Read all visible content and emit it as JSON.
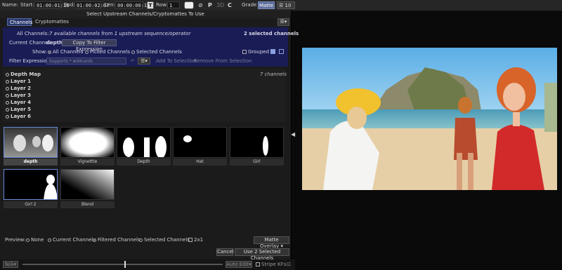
{
  "toolbar": {
    "name_label": "Name:",
    "start_label": "Start:",
    "start_value": "01:00:01:16",
    "end_label": "End:",
    "end_value": "01:00:02:07",
    "len_label": "Len:",
    "len_value": "00:00:00:16",
    "t_icon": "T",
    "row_label": "Row:",
    "row_value": "1",
    "p_icon": "P",
    "three_d": "3D",
    "c_icon": "C",
    "grade_label": "Grade",
    "matte_label": "Matte",
    "layers_value": "10"
  },
  "dialog": {
    "title": "Select Upstream Channels/Cryptomattes To Use",
    "tabs": [
      "Channels",
      "Cryptomattes"
    ],
    "all_channels_label": "All Channels:",
    "all_channels_desc": "7 available channels from 1 upstream sequence/operator",
    "selected_count": "2 selected channels",
    "current_channel_label": "Current Channel:",
    "current_channel_value": "depth",
    "copy_filter_button": "Copy To Filter Expression",
    "show_label": "Show:",
    "show_options": [
      "All Channels",
      "Picked Channels",
      "Selected Channels"
    ],
    "grouped_label": "Grouped",
    "filter_label": "Filter Expression:",
    "filter_placeholder": "Supports * wildcards",
    "add_selection": "Add To Selection",
    "remove_selection": "Remove From Selection",
    "channel_tree": {
      "root": "Depth Map",
      "count": "7 channels",
      "layers": [
        "Layer 1",
        "Layer 2",
        "Layer 3",
        "Layer 4",
        "Layer 5",
        "Layer 6"
      ]
    },
    "thumbnails": [
      "depth",
      "Vignettte",
      "Depth",
      "Hat",
      "Girl",
      "Girl 2",
      "Blend"
    ],
    "preview_label": "Preview:",
    "preview_options": [
      "None",
      "Current Channel",
      "Filtered Channels",
      "Selected Channels"
    ],
    "two_x_one": "2x1",
    "overlay_select": "Matte Overlay",
    "cancel_button": "Cancel",
    "use_button": "Use 2 Selected Channels"
  },
  "bottom": {
    "na_value": "N/A",
    "auto_edit": "Auto Edit",
    "stripe_kfs": "Stripe KFs"
  },
  "colors": {
    "accent": "#2b3a6e",
    "panel_blue": "#1a1c55"
  }
}
